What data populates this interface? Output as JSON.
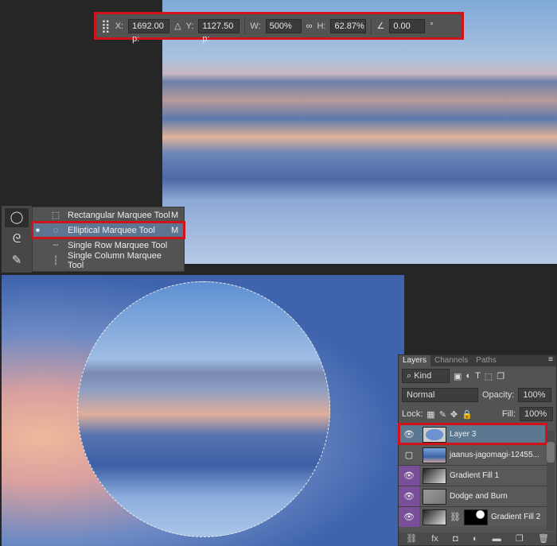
{
  "toolbar": {
    "icon": "reference-point-grid-icon",
    "x_label": "X:",
    "x_value": "1692.00 p:",
    "delta_icon": "triangle-icon",
    "y_label": "Y:",
    "y_value": "1127.50 p:",
    "w_label": "W:",
    "w_value": "500%",
    "link_icon": "link-icon",
    "h_label": "H:",
    "h_value": "62.87%",
    "angle_icon": "angle-icon",
    "angle_value": "0.00",
    "degree": "°"
  },
  "flyout": {
    "items": [
      {
        "label": "Rectangular Marquee Tool",
        "key": "M",
        "icon": "rectangular-marquee-icon",
        "glyph": "⬚",
        "selected": false,
        "dot": ""
      },
      {
        "label": "Elliptical Marquee Tool",
        "key": "M",
        "icon": "elliptical-marquee-icon",
        "glyph": "◌",
        "selected": true,
        "dot": "■"
      },
      {
        "label": "Single Row Marquee Tool",
        "key": "",
        "icon": "single-row-marquee-icon",
        "glyph": "┄",
        "selected": false,
        "dot": ""
      },
      {
        "label": "Single Column Marquee Tool",
        "key": "",
        "icon": "single-column-marquee-icon",
        "glyph": "┆",
        "selected": false,
        "dot": ""
      }
    ]
  },
  "tools": [
    {
      "icon": "elliptical-marquee-icon",
      "glyph": "◯"
    },
    {
      "icon": "lasso-icon",
      "glyph": "ᘓ"
    },
    {
      "icon": "quick-selection-icon",
      "glyph": "✎"
    }
  ],
  "layers": {
    "tabs": [
      "Layers",
      "Channels",
      "Paths"
    ],
    "kind": "Kind",
    "blend": "Normal",
    "opacity_label": "Opacity:",
    "opacity": "100%",
    "lock_label": "Lock:",
    "fill_label": "Fill:",
    "fill": "100%",
    "filter_icons": [
      "▣",
      "◐",
      "T",
      "⬚",
      "❐"
    ],
    "lock_icons": [
      "▦",
      "✎",
      "✥",
      "🔒"
    ],
    "items": [
      {
        "name": "Layer 3",
        "visible": true,
        "selected": true
      },
      {
        "name": "jaanus-jagomagi-12455...",
        "visible": false,
        "selected": false
      },
      {
        "name": "Gradient Fill 1",
        "visible": true,
        "selected": false
      },
      {
        "name": "Dodge and Burn",
        "visible": true,
        "selected": false
      },
      {
        "name": "Gradient Fill 2",
        "visible": true,
        "selected": false
      }
    ],
    "bottom_icons": [
      "⛓",
      "fx",
      "◘",
      "◐",
      "▬",
      "❐",
      "🗑"
    ],
    "accent": "#7a4f9a"
  },
  "highlight_color": "#d0121b"
}
